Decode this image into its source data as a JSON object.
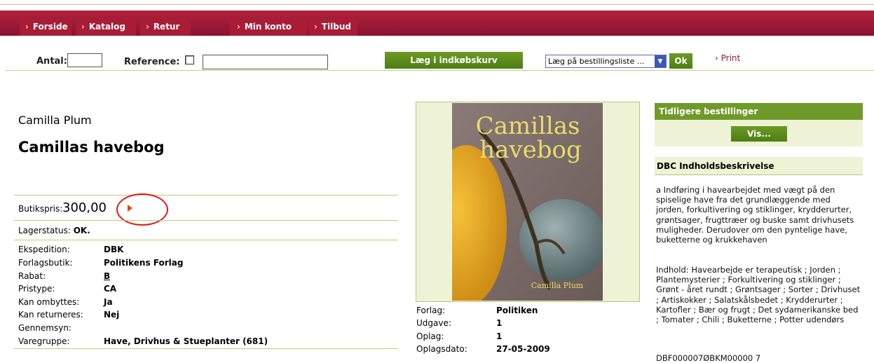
{
  "nav": {
    "tabs": [
      {
        "label": "Forside"
      },
      {
        "label": "Katalog"
      },
      {
        "label": "Retur"
      },
      {
        "label": "Min konto"
      },
      {
        "label": "Tilbud"
      }
    ],
    "arrow": "›"
  },
  "toolbar": {
    "antal_label": "Antal:",
    "antal_value": "",
    "reference_label": "Reference:",
    "reference_value": "",
    "add_to_cart_label": "Læg i indkøbskurv",
    "order_list_selected": "Læg på bestillingsliste ...",
    "ok_label": "Ok",
    "print_label": "Print"
  },
  "product": {
    "author": "Camilla Plum",
    "title": "Camillas havebog",
    "price_label": "Butikspris:",
    "price_value": "300,00",
    "stock_label": "Lagerstatus:",
    "stock_value": "OK.",
    "details": [
      {
        "key": "Ekspedition:",
        "value": "DBK"
      },
      {
        "key": "Forlagsbutik:",
        "value": "Politikens Forlag"
      },
      {
        "key": "Rabat:",
        "value": "B"
      },
      {
        "key": "Pristype:",
        "value": "CA"
      },
      {
        "key": "Kan ombyttes:",
        "value": "Ja"
      },
      {
        "key": "Kan returneres:",
        "value": "Nej"
      },
      {
        "key": "Gennemsyn:",
        "value": ""
      },
      {
        "key": "Varegruppe:",
        "value": "Have, Drivhus & Stueplanter (681)"
      }
    ]
  },
  "cover": {
    "title_line1": "Camillas",
    "title_line2": "havebog",
    "author": "Camilla Plum"
  },
  "publication": [
    {
      "key": "Forlag:",
      "value": "Politiken"
    },
    {
      "key": "Udgave:",
      "value": "1"
    },
    {
      "key": "Oplag:",
      "value": "1"
    },
    {
      "key": "Oplagsdato:",
      "value": "27-05-2009"
    }
  ],
  "sidebar": {
    "previous_orders_title": "Tidligere bestillinger",
    "show_button": "Vis...",
    "dbc_title": "DBC Indholdsbeskrivelse",
    "description": "a Indføring i havearbejdet med vægt på den spiselige have fra det grundlæggende med jorden, forkultivering og stiklinger, krydderurter, grøntsager, frugttræer og buske samt drivhusets muligheder. Derudover om den pyntelige have, buketterne og krukkehaven",
    "contents": "Indhold: Havearbejde er terapeutisk ; Jorden ; Plantemysterier ; Forkultivering og stiklinger ; Grønt - året rundt ; Grøntsager ; Sorter ; Drivhuset ; Artiskokker ; Salatskålsbedet ; Krydderurter ; Kartofler ; Bær og frugt ; Det sydamerikanske bed ; Tomater ; Chili ; Buketterne ; Potter udendørs",
    "partial_code": "DBF000007ØBKM00000 7"
  },
  "colors": {
    "nav_bg": "#a81c36",
    "green_button": "#5a8a1a",
    "panel_bg": "#eef3d6",
    "highlight_circle": "#e01818"
  }
}
